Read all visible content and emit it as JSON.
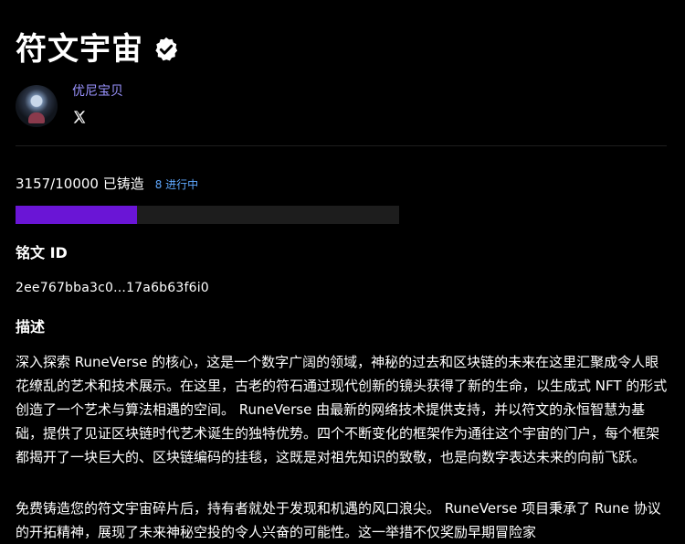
{
  "collection": {
    "title": "符文宇宙",
    "verified_icon": "verified-badge-icon"
  },
  "creator": {
    "name": "优尼宝贝",
    "avatar_icon": "avatar",
    "social_icon": "x-twitter-icon"
  },
  "mint": {
    "count_text": "3157/10000 已铸造",
    "in_progress_text": "8 进行中",
    "progress_fraction": 0.3157,
    "bar_color": "#6a15d6"
  },
  "inscription": {
    "heading": "铭文 ID",
    "id": "2ee767bba3c0...17a6b63f6i0"
  },
  "description": {
    "heading": "描述",
    "paragraph1": "深入探索 RuneVerse 的核心，这是一个数字广阔的领域，神秘的过去和区块链的未来在这里汇聚成令人眼花缭乱的艺术和技术展示。在这里，古老的符石通过现代创新的镜头获得了新的生命，以生成式 NFT 的形式创造了一个艺术与算法相遇的空间。 RuneVerse 由最新的网络技术提供支持，并以符文的永恒智慧为基础，提供了见证区块链时代艺术诞生的独特优势。四个不断变化的框架作为通往这个宇宙的门户，每个框架都揭开了一块巨大的、区块链编码的挂毯，这既是对祖先知识的致敬，也是向数字表达未来的向前飞跃。",
    "paragraph2": "免费铸造您的符文宇宙碎片后，持有者就处于发现和机遇的风口浪尖。 RuneVerse 项目秉承了 Rune 协议的开拓精神，展现了未来神秘空投的令人兴奋的可能性。这一举措不仅奖励早期冒险家"
  }
}
